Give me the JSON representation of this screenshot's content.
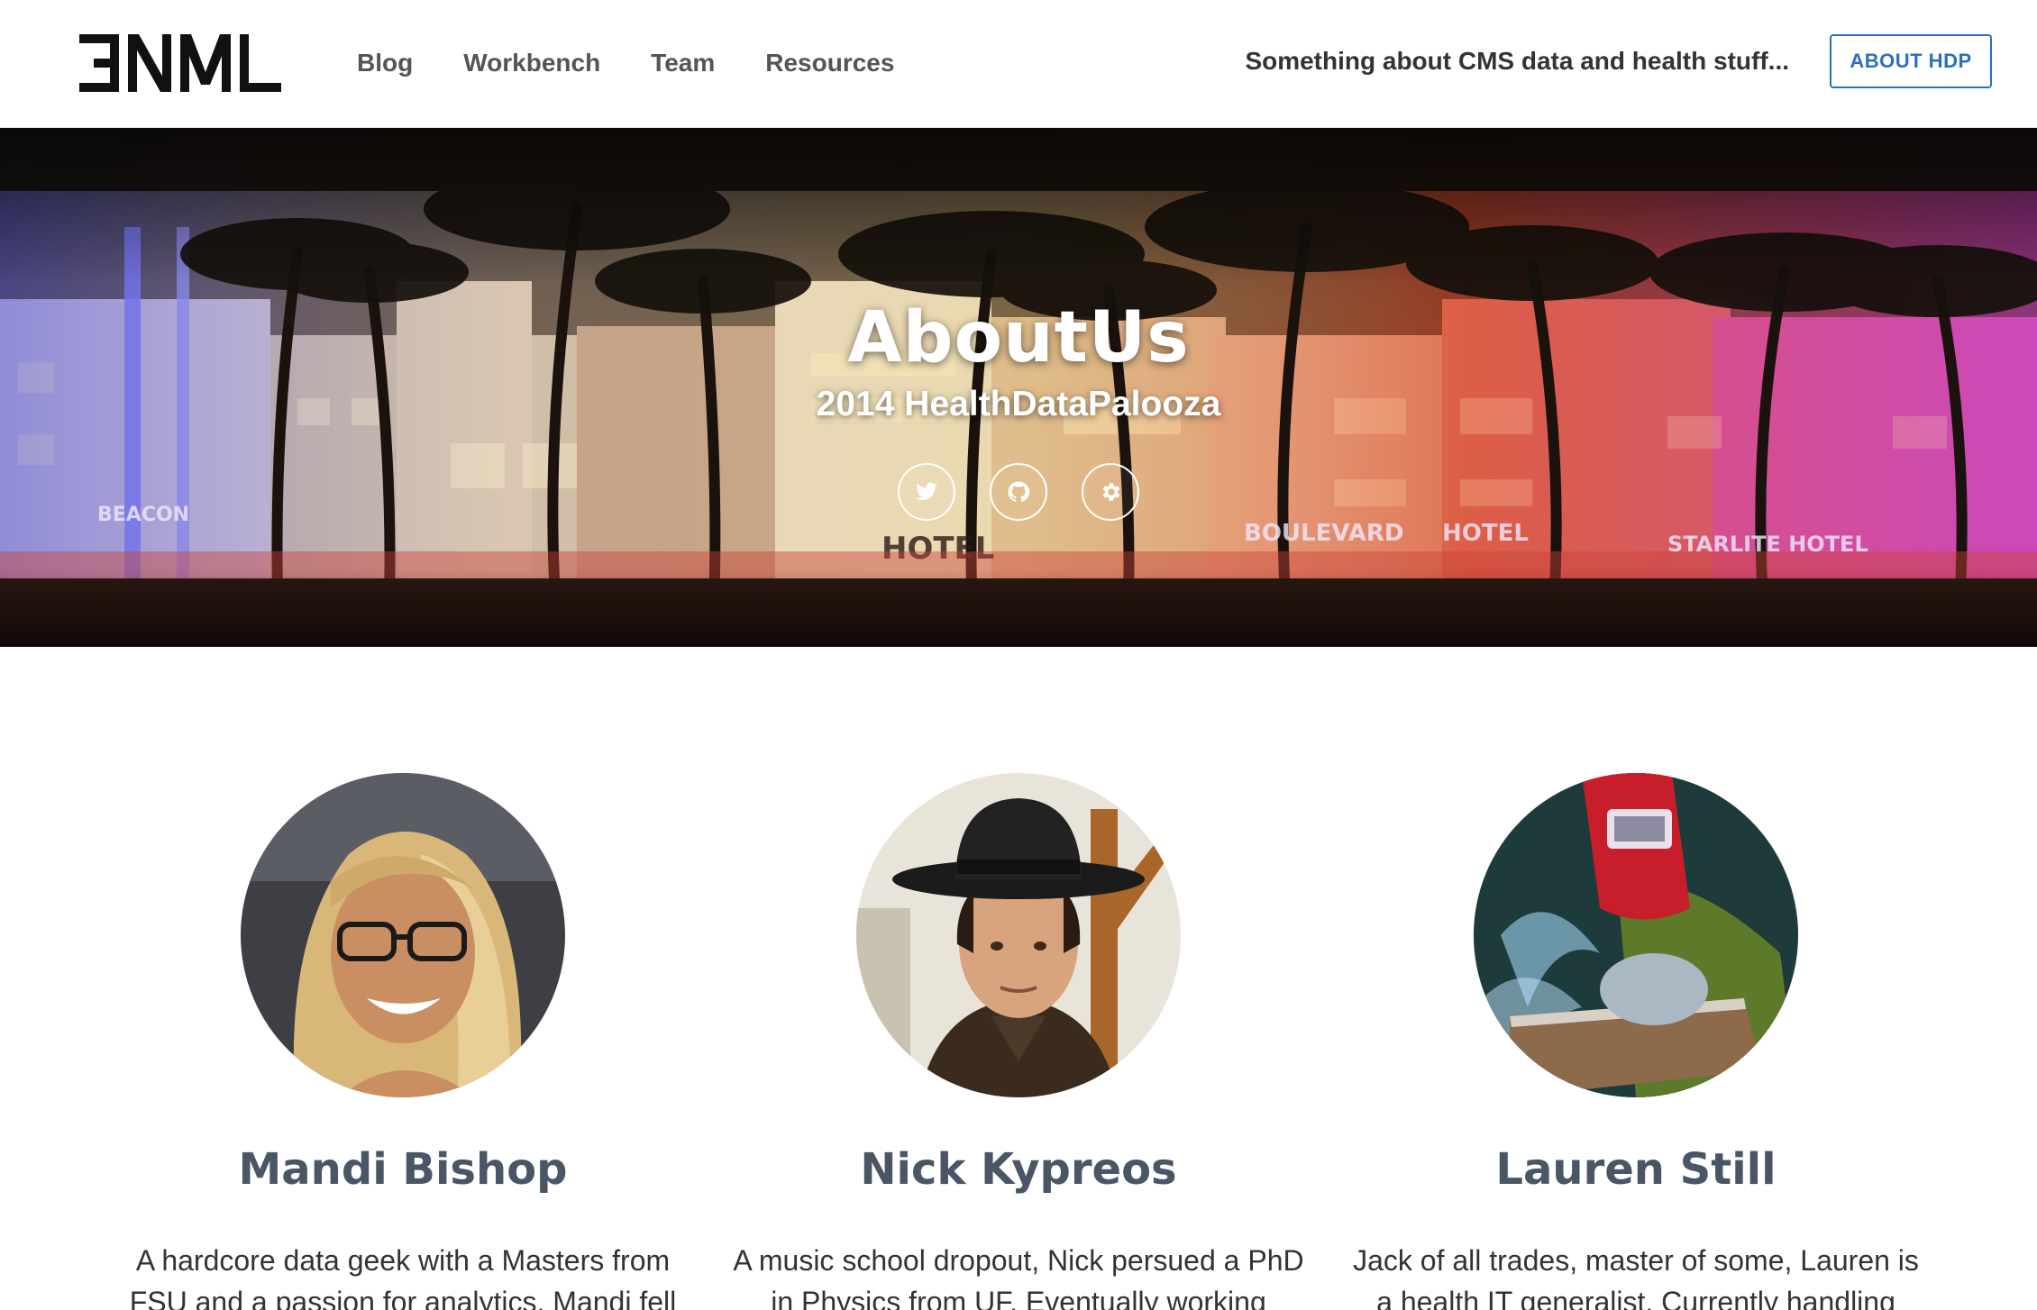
{
  "navbar": {
    "logo_text": "ƎNML",
    "links": [
      {
        "label": "Blog"
      },
      {
        "label": "Workbench"
      },
      {
        "label": "Team"
      },
      {
        "label": "Resources"
      }
    ],
    "tagline": "Something about CMS data and health stuff...",
    "about_button": "ABOUT HDP",
    "accent_color": "#2b6fc2"
  },
  "hero": {
    "title": "AboutUs",
    "subtitle": "2014 HealthDataPalooza",
    "social_icons": [
      "twitter-icon",
      "github-icon",
      "gear-icon"
    ],
    "background_signs": [
      "BEACON",
      "HOTEL",
      "HOTEL",
      "BOULEVARD",
      "HOTEL",
      "STARLITE HOTEL"
    ]
  },
  "team": [
    {
      "name": "Mandi Bishop",
      "bio": "A hardcore data geek with a Masters from FSU and a passion for analytics, Mandi fell",
      "avatar": "avatar-mandi-bishop"
    },
    {
      "name": "Nick Kypreos",
      "bio": "A music school dropout, Nick persued a PhD in Physics from UF. Eventually working",
      "avatar": "avatar-nick-kypreos"
    },
    {
      "name": "Lauren Still",
      "bio": "Jack of all trades, master of some, Lauren is a health IT generalist. Currently handling",
      "avatar": "avatar-lauren-still"
    }
  ],
  "colors": {
    "name_color": "#4a5566",
    "text_color": "#333333"
  }
}
